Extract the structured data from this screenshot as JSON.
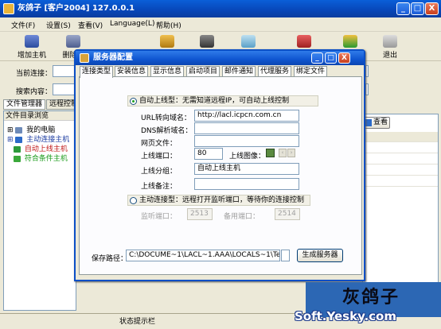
{
  "main_window": {
    "title": "灰鸽子 [客户2004]    127.0.0.1",
    "minimize": "_",
    "maximize": "□",
    "close": "X"
  },
  "menu": [
    "文件(F)",
    "设置(S)",
    "查看(V)",
    "Language(L)",
    "帮助(H)"
  ],
  "toolbar": {
    "add_host": "增加主机",
    "delete_host": "删除主",
    "exit": "退出"
  },
  "rows": {
    "current_connection": "当前连接：",
    "search_content": "搜索内容："
  },
  "left_tabs": [
    "文件管理器",
    "远程控制"
  ],
  "tree": {
    "header": "文件目录浏览",
    "nodes": [
      "我的电脑",
      "主动连接主机",
      "自动上线主机",
      "符合条件主机"
    ]
  },
  "right_panel": {
    "view_button": "查看"
  },
  "status_bar": "状态提示栏",
  "dialog": {
    "title": "服务器配置",
    "minimize": "_",
    "maximize": "□",
    "close": "X",
    "tabs": [
      "连接类型",
      "安装信息",
      "显示信息",
      "启动项目",
      "邮件通知",
      "代理服务",
      "绑定文件"
    ],
    "auto_online_type": "自动上线型：无需知道远程IP，可自动上线控制",
    "url_label": "URL转向域名：",
    "url_value": "http://lacl.icpcn.com.cn",
    "dns_label": "DNS解析域名：",
    "web_label": "网页文件：",
    "port_label": "上线端口：",
    "port_value": "80",
    "image_label": "上线图像：",
    "group_label": "上线分组：",
    "group_value": "自动上线主机",
    "remark_label": "上线备注：",
    "active_type": "主动连接型：远程打开监听端口，等待你的连接控制",
    "listen_label": "监听端口：",
    "listen_value": "2513",
    "backup_label": "备用端口：",
    "backup_value": "2514",
    "save_path_label": "保存路径：",
    "save_path_value": "C:\\DOCUME~1\\LACL~1.AAA\\LOCALS~1\\Temp\\Rar$EX",
    "generate_button": "生成服务器"
  },
  "watermark": {
    "brush_text": "灰鸽子",
    "site": "Soft.Yesky.com"
  }
}
